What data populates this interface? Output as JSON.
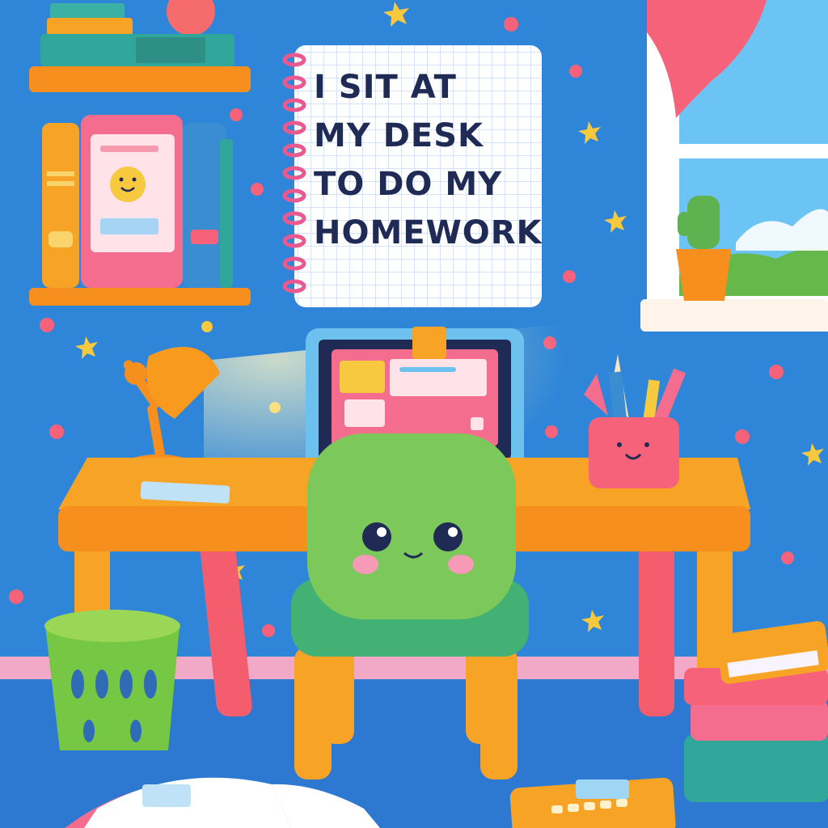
{
  "notepad": {
    "lines": [
      "I SIT AT",
      "MY DESK",
      "TO DO MY",
      "HOMEWORK"
    ]
  },
  "colors": {
    "wall": "#2f86d8",
    "desk": "#f7a325",
    "chair": "#7cc85a",
    "notepad": "#ffffff",
    "grid": "#c9d9f2",
    "text": "#1f2a55",
    "curtain": "#f6627a"
  }
}
